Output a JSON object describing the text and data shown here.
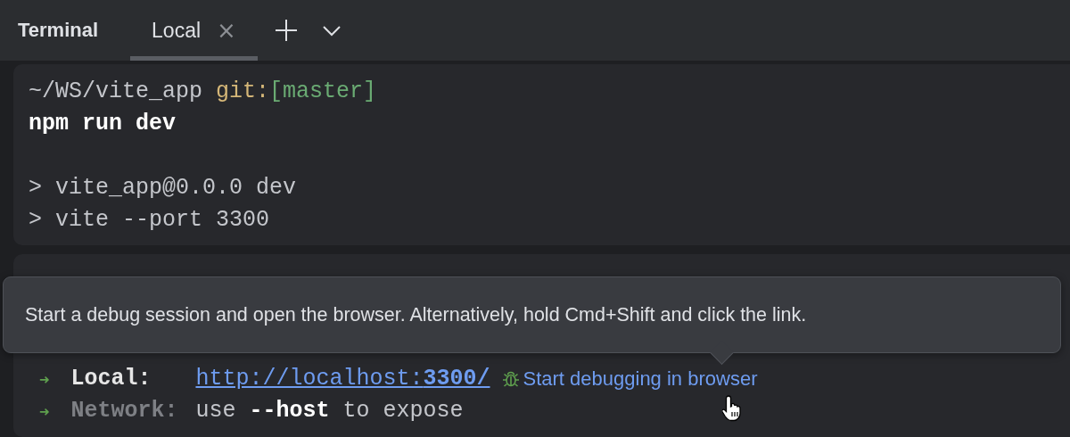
{
  "header": {
    "title": "Terminal",
    "tabs": [
      {
        "label": "Local",
        "selected": true,
        "close": "×"
      }
    ]
  },
  "session": {
    "prompt": {
      "path": "~/WS/vite_app",
      "git_label": "git:",
      "branch": "[master]"
    },
    "command": "npm run dev",
    "output": [
      "> vite_app@0.0.0 dev",
      "> vite --port 3300"
    ]
  },
  "tooltip": {
    "text": "Start a debug session and open the browser. Alternatively, hold Cmd+Shift and click the link."
  },
  "server_lines": [
    {
      "kind": "link",
      "arrow": "➜",
      "label": "Local:",
      "link": "http://localhost:**3300/**",
      "action": "Start debugging in browser"
    },
    {
      "kind": "text",
      "arrow": "➜",
      "label": "Network:",
      "text": "use **--host** to expose"
    }
  ]
}
